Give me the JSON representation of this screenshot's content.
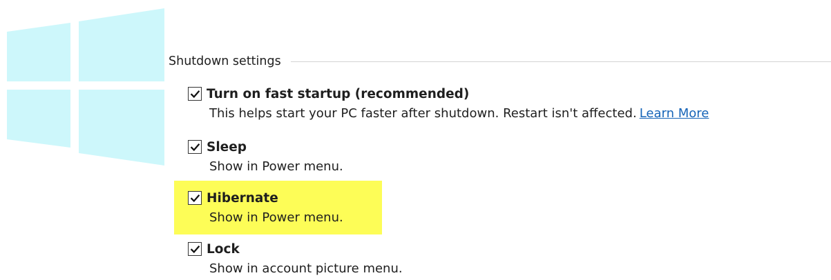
{
  "section": {
    "title": "Shutdown settings"
  },
  "options": [
    {
      "label": "Turn on fast startup (recommended)",
      "checked": true,
      "description": "This helps start your PC faster after shutdown. Restart isn't affected.",
      "link": "Learn More"
    },
    {
      "label": "Sleep",
      "checked": true,
      "description": "Show in Power menu."
    },
    {
      "label": "Hibernate",
      "checked": true,
      "description": "Show in Power menu."
    },
    {
      "label": "Lock",
      "checked": true,
      "description": "Show in account picture menu."
    }
  ],
  "colors": {
    "highlight": "#fdfd57",
    "link": "#1664b8",
    "logo": "#cdf7fb"
  },
  "icons": {
    "logo": "windows-logo-icon",
    "checkmark": "checkmark-icon"
  }
}
